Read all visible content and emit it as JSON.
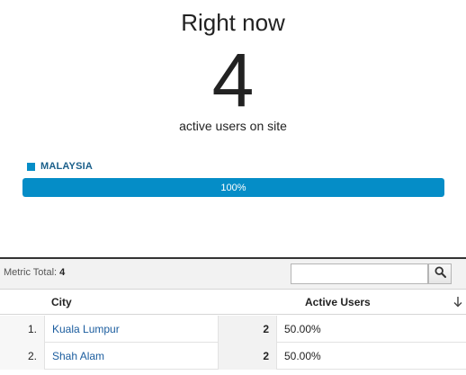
{
  "hero": {
    "title": "Right now",
    "count": "4",
    "caption": "active users on site"
  },
  "country_bar": {
    "label": "MALAYSIA",
    "percent_text": "100%",
    "fill_fraction": 1.0,
    "color": "#058dc7"
  },
  "toolbar": {
    "metric_total_label": "Metric Total:",
    "metric_total_value": "4",
    "search_value": "",
    "search_icon": "search-icon"
  },
  "table": {
    "columns": {
      "city": "City",
      "users": "Active Users"
    },
    "sort_icon": "arrow-down-icon",
    "rows": [
      {
        "index": "1.",
        "city": "Kuala Lumpur",
        "count": "2",
        "percent": "50.00%"
      },
      {
        "index": "2.",
        "city": "Shah Alam",
        "count": "2",
        "percent": "50.00%"
      }
    ]
  }
}
